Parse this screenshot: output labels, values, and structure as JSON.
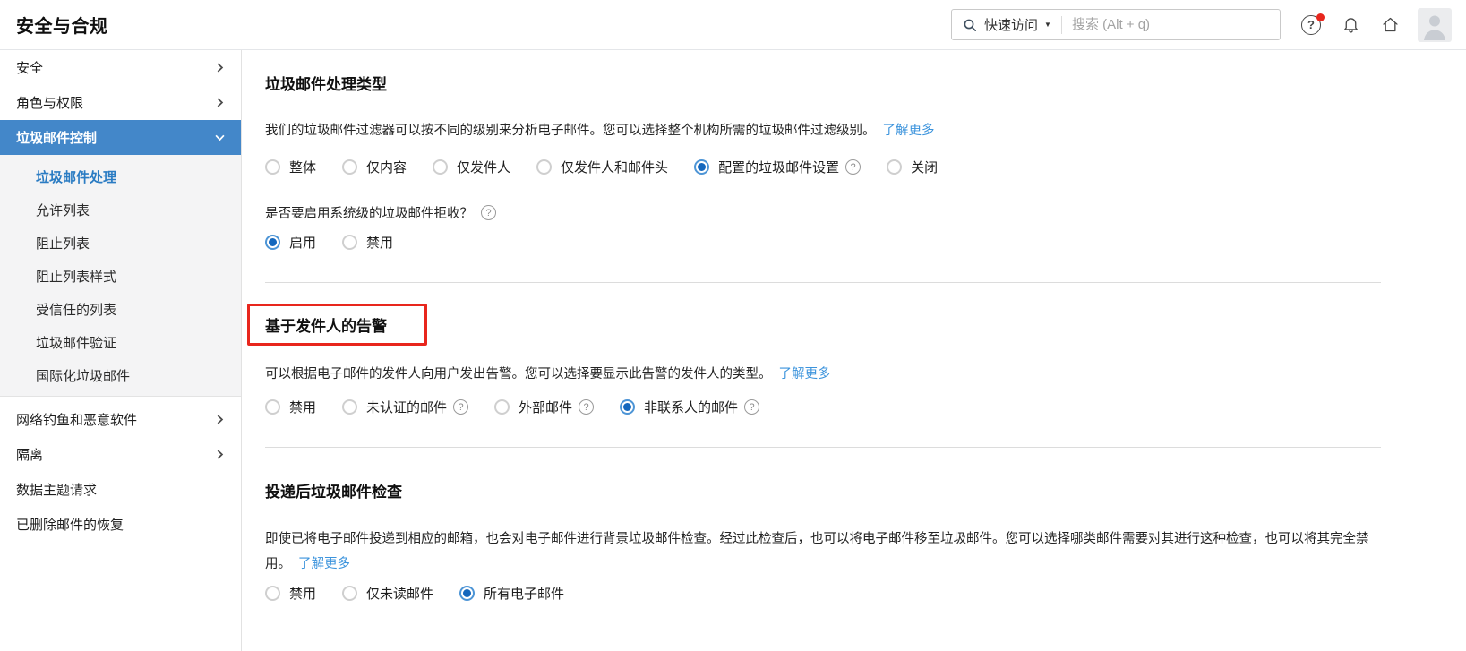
{
  "header": {
    "title": "安全与合规",
    "quick_access_label": "快速访问",
    "search_placeholder": "搜索 (Alt + q)"
  },
  "sidebar": {
    "top_items": [
      {
        "label": "安全"
      },
      {
        "label": "角色与权限"
      },
      {
        "label": "垃圾邮件控制",
        "active": true,
        "expanded": true
      }
    ],
    "sub_items": [
      {
        "label": "垃圾邮件处理",
        "selected": true
      },
      {
        "label": "允许列表"
      },
      {
        "label": "阻止列表"
      },
      {
        "label": "阻止列表样式"
      },
      {
        "label": "受信任的列表"
      },
      {
        "label": "垃圾邮件验证"
      },
      {
        "label": "国际化垃圾邮件"
      }
    ],
    "bottom_items": [
      {
        "label": "网络钓鱼和恶意软件",
        "chevron": true
      },
      {
        "label": "隔离",
        "chevron": true
      },
      {
        "label": "数据主题请求"
      },
      {
        "label": "已删除邮件的恢复"
      }
    ]
  },
  "spam_processing": {
    "title": "垃圾邮件处理类型",
    "description": "我们的垃圾邮件过滤器可以按不同的级别来分析电子邮件。您可以选择整个机构所需的垃圾邮件过滤级别。",
    "learn_more": "了解更多",
    "options": [
      {
        "label": "整体",
        "checked": false
      },
      {
        "label": "仅内容",
        "checked": false
      },
      {
        "label": "仅发件人",
        "checked": false
      },
      {
        "label": "仅发件人和邮件头",
        "checked": false
      },
      {
        "label": "配置的垃圾邮件设置",
        "checked": true,
        "help": true
      },
      {
        "label": "关闭",
        "checked": false
      }
    ],
    "system_reject_question": "是否要启用系统级的垃圾邮件拒收？",
    "system_reject_options": [
      {
        "label": "启用",
        "checked": true
      },
      {
        "label": "禁用",
        "checked": false
      }
    ]
  },
  "sender_alert": {
    "title": "基于发件人的告警",
    "description": "可以根据电子邮件的发件人向用户发出告警。您可以选择要显示此告警的发件人的类型。",
    "learn_more": "了解更多",
    "options": [
      {
        "label": "禁用",
        "checked": false
      },
      {
        "label": "未认证的邮件",
        "checked": false,
        "help": true
      },
      {
        "label": "外部邮件",
        "checked": false,
        "help": true
      },
      {
        "label": "非联系人的邮件",
        "checked": true,
        "help": true
      }
    ],
    "annotation": "red-box-highlight"
  },
  "post_delivery": {
    "title": "投递后垃圾邮件检查",
    "description": "即使已将电子邮件投递到相应的邮箱，也会对电子邮件进行背景垃圾邮件检查。经过此检查后，也可以将电子邮件移至垃圾邮件。您可以选择哪类邮件需要对其进行这种检查，也可以将其完全禁用。",
    "learn_more": "了解更多",
    "options": [
      {
        "label": "禁用",
        "checked": false
      },
      {
        "label": "仅未读邮件",
        "checked": false
      },
      {
        "label": "所有电子邮件",
        "checked": true
      }
    ]
  },
  "colors": {
    "sidebar_active_blue": "#4387c9",
    "submenu_selected_blue": "#2b7cc3",
    "link_blue": "#3b93dc",
    "radio_checked_blue": "#1467bd",
    "annotation_red": "#e8261d"
  }
}
